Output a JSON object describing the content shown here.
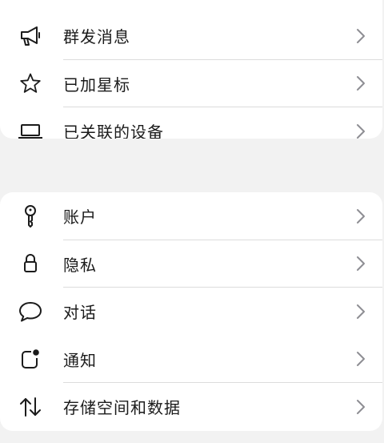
{
  "group1": {
    "items": [
      {
        "label": "群发消息",
        "icon": "megaphone-icon"
      },
      {
        "label": "已加星标",
        "icon": "star-icon"
      },
      {
        "label": "已关联的设备",
        "icon": "laptop-icon"
      }
    ]
  },
  "group2": {
    "items": [
      {
        "label": "账户",
        "icon": "key-icon"
      },
      {
        "label": "隐私",
        "icon": "lock-icon"
      },
      {
        "label": "对话",
        "icon": "chat-bubble-icon"
      },
      {
        "label": "通知",
        "icon": "notification-badge-icon"
      },
      {
        "label": "存储空间和数据",
        "icon": "up-down-arrows-icon"
      }
    ]
  },
  "colors": {
    "background": "#f2f2f2",
    "card": "#ffffff",
    "text": "#1b1b1b",
    "chevron": "#8e8e93",
    "divider": "#dcdcdc"
  }
}
